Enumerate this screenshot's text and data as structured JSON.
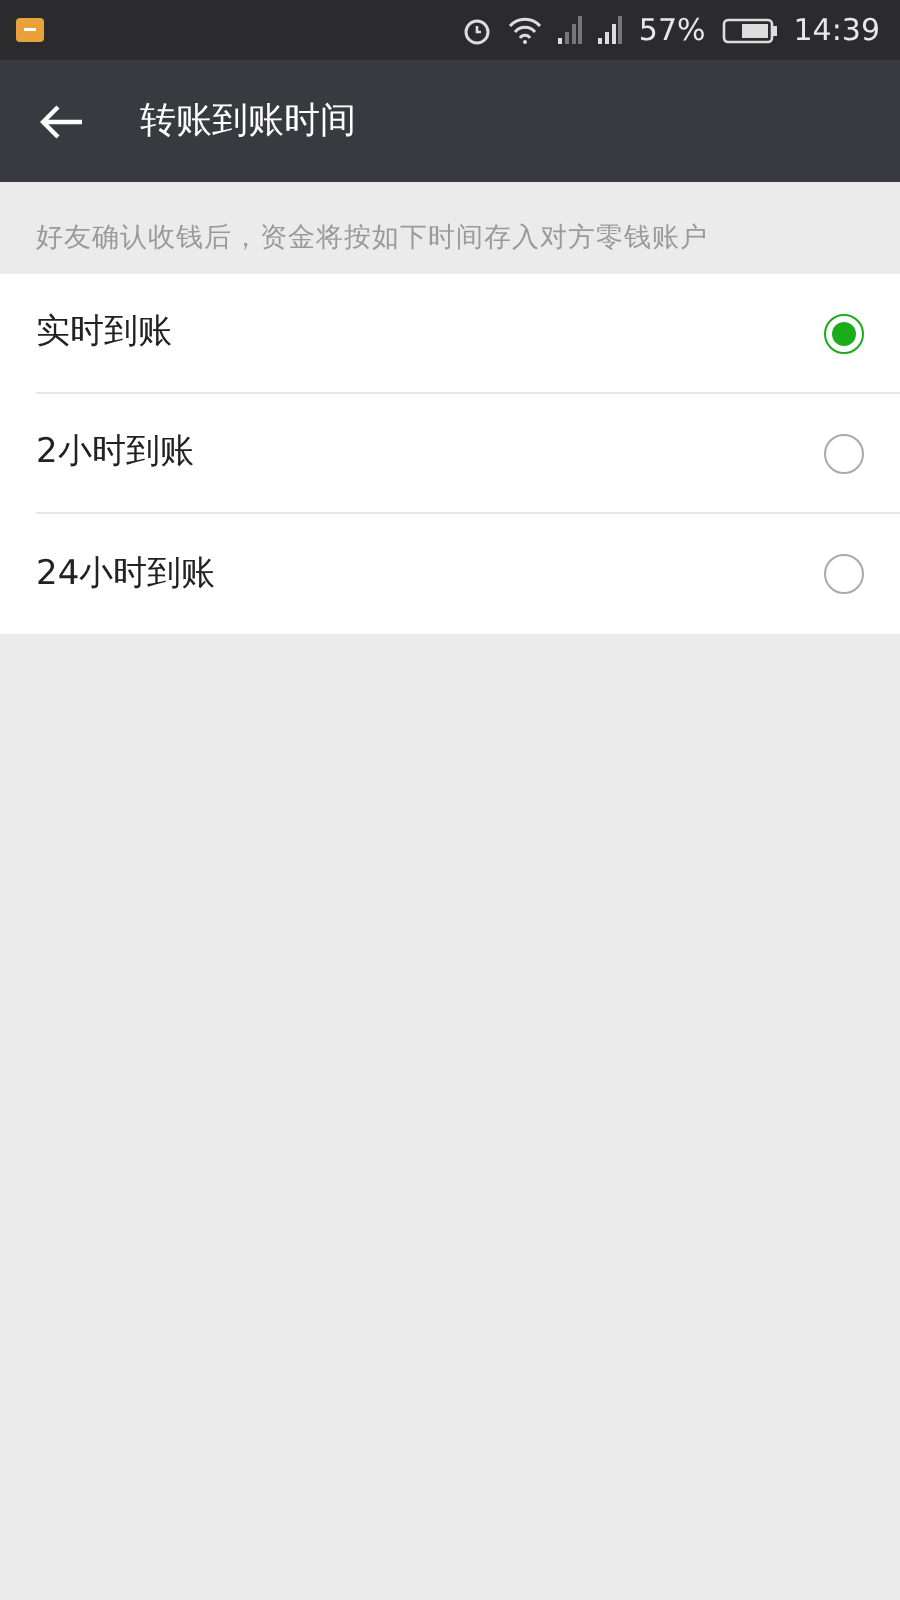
{
  "status_bar": {
    "battery": "57%",
    "time": "14:39"
  },
  "app_bar": {
    "title": "转账到账时间"
  },
  "hint": "好友确认收钱后，资金将按如下时间存入对方零钱账户",
  "options": [
    {
      "label": "实时到账",
      "selected": true
    },
    {
      "label": "2小时到账",
      "selected": false
    },
    {
      "label": "24小时到账",
      "selected": false
    }
  ]
}
